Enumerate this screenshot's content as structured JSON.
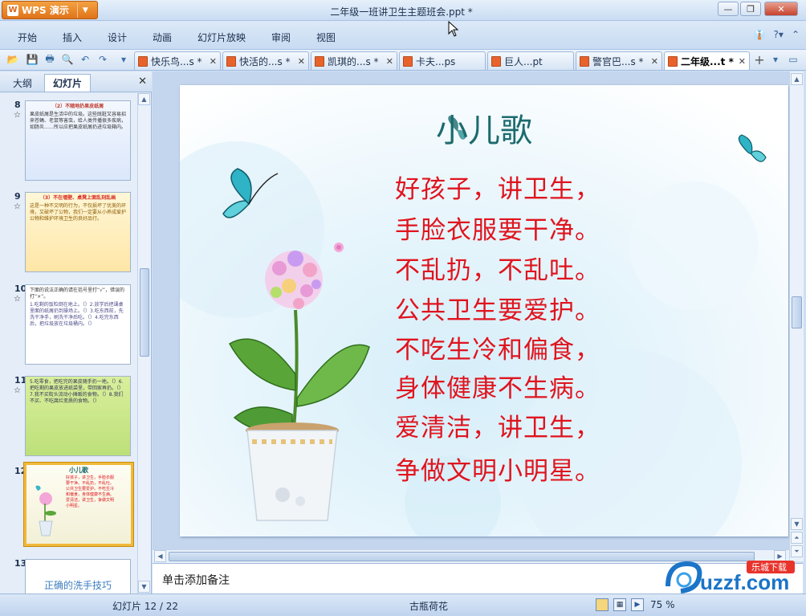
{
  "app": {
    "name": "WPS 演示",
    "doc_title": "二年级一班讲卫生主题班会.ppt *"
  },
  "menu": [
    "开始",
    "插入",
    "设计",
    "动画",
    "幻灯片放映",
    "审阅",
    "视图"
  ],
  "doc_tabs": [
    {
      "label": "快乐鸟...s *",
      "active": false
    },
    {
      "label": "快活的...s *",
      "active": false
    },
    {
      "label": "凯琪的...s *",
      "active": false
    },
    {
      "label": "卡夫...ps",
      "active": false
    },
    {
      "label": "巨人...pt",
      "active": false
    },
    {
      "label": "警官巴...s *",
      "active": false
    },
    {
      "label": "二年级...t *",
      "active": true
    }
  ],
  "left_panel": {
    "tabs": [
      "大纲",
      "幻灯片"
    ],
    "slides": [
      {
        "num": "8",
        "title": "（2）不随地扔果皮纸屑",
        "body": "果皮纸屑是生活中的垃圾。这些既脏又容易招来苍蝇、老鼠等害虫，给人类传播很多疾病，如肠炎……所以应把果皮纸屑扔进垃圾箱内。"
      },
      {
        "num": "9",
        "title": "（3）不在墙壁、桌凳上面乱刻乱画",
        "body": "这是一种不文明的行为，不仅损坏了优美的环境，又破坏了公物，我们一定要从小养成爱护公物和维护环境卫生的良好品行。"
      },
      {
        "num": "10",
        "title": "下面的说法正确的请在括号里打“√”，错误的打“×”。",
        "body": "1.吃剩的饭粒倒在地上。（）2.放学后把课桌里面的纸屑扔到操场上。（）3.吃东西前，先洗干净手，刷洗干净后吃。（）4.吃完东西后，把垃圾放在垃圾桶内。（）"
      },
      {
        "num": "11",
        "title": "",
        "body": "5.吃零食，把吃完的果皮随手扔一地。（）6.把吃剩的果皮放进纸袋里，带回家再扔。（）7.我不买街头流动小摊贩的食物。（）8.我们不买、不吃腐烂变质的食物。（）"
      },
      {
        "num": "12",
        "title": "小儿歌",
        "body": "好孩子，讲卫生，手脸衣服要干净。不乱扔，不乱吐。公共卫生要爱护。不吃生冷和偏食，身体健康不生病。爱清洁，讲卫生，争做文明小明星。"
      },
      {
        "num": "13",
        "title": "正确的洗手技巧",
        "body": ""
      }
    ]
  },
  "slide": {
    "title": "小儿歌",
    "lines": [
      "好孩子，讲卫生，",
      "手脸衣服要干净。",
      "不乱扔，不乱吐。",
      "公共卫生要爱护。",
      "不吃生冷和偏食，",
      "身体健康不生病。",
      "爱清洁，讲卫生，",
      "争做文明小明星。"
    ]
  },
  "notes_placeholder": "单击添加备注",
  "status": {
    "slide_counter": "幻灯片 12 / 22",
    "theme": "古瓶荷花",
    "zoom": "75 %"
  },
  "watermark": {
    "brand": "uzzf.com",
    "badge": "乐城下载"
  },
  "colors": {
    "poem_red": "#e0141e",
    "title_teal": "#1c6b6e",
    "wps_orange": "#e0731a"
  }
}
